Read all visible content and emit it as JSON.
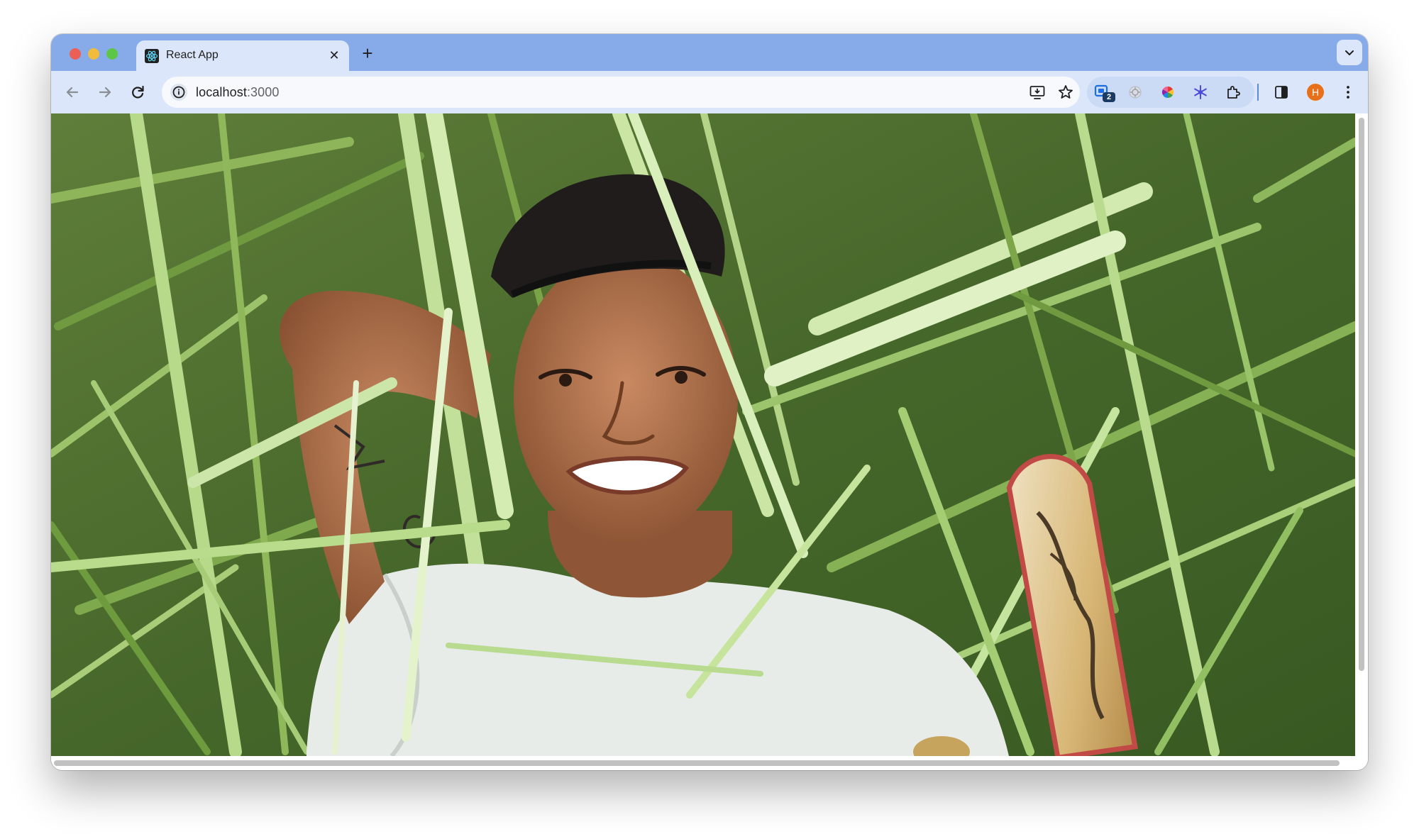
{
  "browser": {
    "tab": {
      "title": "React App",
      "favicon": "react-logo-icon",
      "close_glyph": "✕"
    },
    "new_tab_glyph": "+",
    "address_bar": {
      "host": "localhost",
      "port": ":3000"
    },
    "profile_initial": "H",
    "colors": {
      "frame": "#87abe8",
      "toolbar": "#dbe6fa",
      "omnibox": "#f7f9fd",
      "avatar": "#e8701a"
    }
  },
  "extensions": {
    "first_badge": "2",
    "icons": [
      "tab-manager-icon",
      "sync-icon",
      "color-wheel-icon",
      "snowflake-icon",
      "puzzle-icon"
    ]
  },
  "page": {
    "media": "photo of a smiling person lying in tall green grass next to a skateboard"
  }
}
